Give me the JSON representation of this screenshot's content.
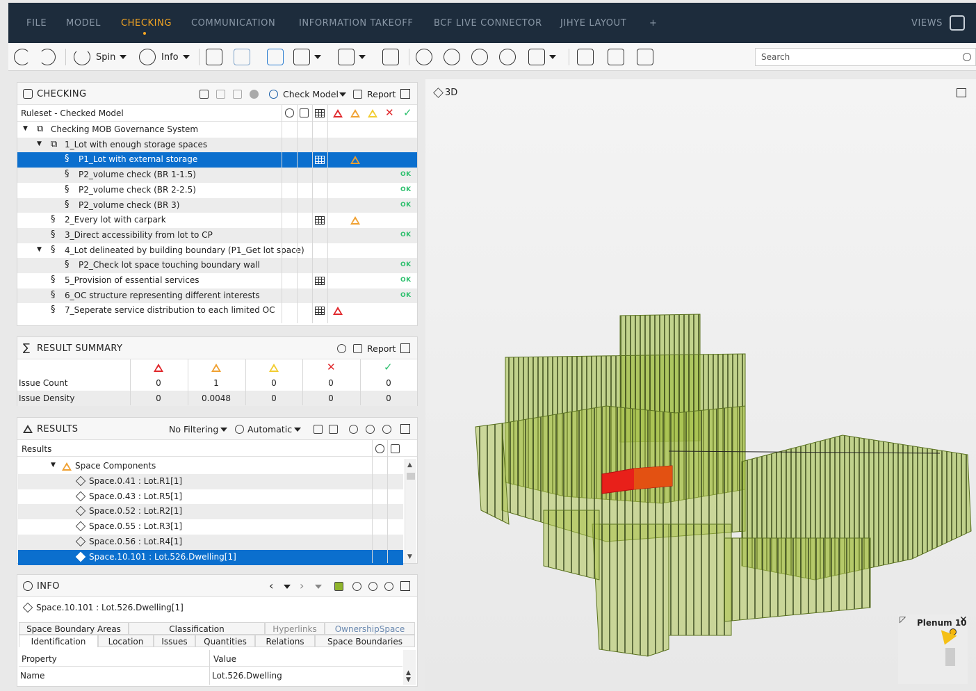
{
  "menu": {
    "items": [
      "FILE",
      "MODEL",
      "CHECKING",
      "COMMUNICATION",
      "INFORMATION TAKEOFF",
      "BCF LIVE CONNECTOR",
      "JIHYE LAYOUT",
      "+"
    ],
    "active": "CHECKING",
    "views": "VIEWS",
    "accent": "#f5a623"
  },
  "toolbar": {
    "spin": "Spin",
    "info": "Info",
    "search_placeholder": "Search"
  },
  "checking": {
    "title": "CHECKING",
    "check_model": "Check Model",
    "report": "Report",
    "column_header": "Ruleset - Checked Model",
    "rows": [
      {
        "label": "Checking MOB Governance System",
        "indent": 0,
        "expander": "▼",
        "icon": "ruleset"
      },
      {
        "label": "1_Lot with enough storage spaces",
        "indent": 1,
        "expander": "▼",
        "icon": "ruleset"
      },
      {
        "label": "P1_Lot with external storage",
        "indent": 2,
        "icon": "rule",
        "selected": true,
        "grid": true,
        "status": "orange"
      },
      {
        "label": "P2_volume check (BR 1-1.5)",
        "indent": 2,
        "icon": "rule",
        "status": "ok",
        "ok": "OK"
      },
      {
        "label": "P2_volume check (BR 2-2.5)",
        "indent": 2,
        "icon": "rule",
        "status": "ok",
        "ok": "OK"
      },
      {
        "label": "P2_volume check (BR 3)",
        "indent": 2,
        "icon": "rule",
        "status": "ok",
        "ok": "OK"
      },
      {
        "label": "2_Every lot with carpark",
        "indent": 1,
        "icon": "rule",
        "grid": true,
        "status": "orange"
      },
      {
        "label": "3_Direct accessibility from lot to CP",
        "indent": 1,
        "icon": "rule",
        "status": "ok",
        "ok": "OK"
      },
      {
        "label": "4_Lot delineated by building boundary (P1_Get lot space)",
        "indent": 1,
        "expander": "▼",
        "icon": "rule"
      },
      {
        "label": "P2_Check lot space touching boundary wall",
        "indent": 2,
        "icon": "rule",
        "status": "ok",
        "ok": "OK"
      },
      {
        "label": "5_Provision of essential services",
        "indent": 1,
        "icon": "rule",
        "grid": true,
        "status": "ok",
        "ok": "OK"
      },
      {
        "label": "6_OC structure representing different interests",
        "indent": 1,
        "icon": "rule",
        "status": "ok",
        "ok": "OK"
      },
      {
        "label": "7_Seperate service distribution to each limited OC",
        "indent": 1,
        "icon": "rule",
        "grid": true,
        "status": "red"
      }
    ]
  },
  "summary": {
    "title": "RESULT SUMMARY",
    "report": "Report",
    "rows": [
      {
        "label": "Issue Count",
        "values": [
          "0",
          "1",
          "0",
          "0",
          "0"
        ]
      },
      {
        "label": "Issue Density",
        "values": [
          "0",
          "0.0048",
          "0",
          "0",
          "0"
        ]
      }
    ]
  },
  "results": {
    "title": "RESULTS",
    "filter": "No Filtering",
    "mode": "Automatic",
    "column_header": "Results",
    "group": "Space Components",
    "items": [
      "Space.0.41 : Lot.R1[1]",
      "Space.0.43 : Lot.R5[1]",
      "Space.0.52 : Lot.R2[1]",
      "Space.0.55 : Lot.R3[1]",
      "Space.0.56 : Lot.R4[1]",
      "Space.10.101 : Lot.526.Dwelling[1]"
    ],
    "selected_index": 5
  },
  "info": {
    "title": "INFO",
    "object": "Space.10.101 : Lot.526.Dwelling[1]",
    "tabs_top": [
      "Space Boundary Areas",
      "Classification",
      "Hyperlinks",
      "OwnershipSpace"
    ],
    "tabs_bottom": [
      "Identification",
      "Location",
      "Issues",
      "Quantities",
      "Relations",
      "Space Boundaries"
    ],
    "active_tab": "Identification",
    "col_property": "Property",
    "col_value": "Value",
    "prop_name": "Name",
    "prop_value": "Lot.526.Dwelling"
  },
  "viewport": {
    "label": "3D",
    "plenum": "Plenum 10",
    "model_color": "#8fb42c",
    "highlight_color": "#e8201a"
  }
}
